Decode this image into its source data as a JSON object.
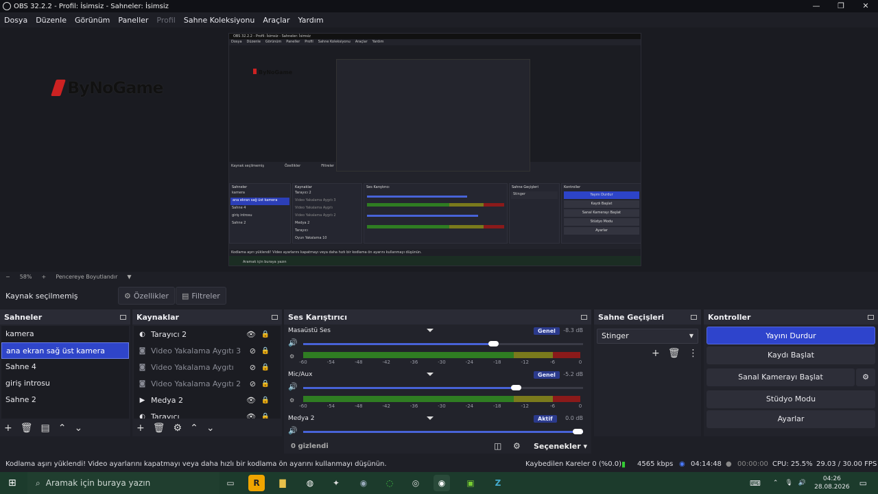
{
  "window": {
    "title": "OBS 32.2.2 - Profil: İsimsiz - Sahneler: İsimsiz",
    "controls": [
      "—",
      "❐",
      "✕"
    ]
  },
  "menu": [
    "Dosya",
    "Düzenle",
    "Görünüm",
    "Paneller",
    "Profil",
    "Sahne Koleksiyonu",
    "Araçlar",
    "Yardım"
  ],
  "preview": {
    "logo_text": "ByNoGame",
    "nested": {
      "title": "OBS 32.2.2 - Profil: İsimsiz - Sahneler: İsimsiz",
      "menu": [
        "Dosya",
        "Düzenle",
        "Görünüm",
        "Paneller",
        "Profil",
        "Sahne Koleksiyonu",
        "Araçlar",
        "Yardım"
      ],
      "logo_text": "ByNoGame",
      "no_source": "Kaynak seçilmemiş",
      "props": "Özellikler",
      "filters": "Filtreler",
      "scenes_title": "Sahneler",
      "scenes": [
        "kamera",
        "ana ekran sağ üst kamera",
        "Sahne 4",
        "giriş introsu",
        "Sahne 2"
      ],
      "sources_title": "Kaynaklar",
      "sources": [
        "Tarayıcı 2",
        "Video Yakalama Aygıtı 3",
        "Video Yakalama Aygıtı",
        "Video Yakalama Aygıtı 2",
        "Medya 2",
        "Tarayıcı",
        "Oyun Yakalama 10"
      ],
      "mixer_title": "Ses Karıştırıcı",
      "transitions_title": "Sahne Geçişleri",
      "transition": "Stinger",
      "controls_title": "Kontroller",
      "controls": [
        "Yayını Durdur",
        "Kaydı Başlat",
        "Sanal Kamerayı Başlat",
        "Stüdyo Modu",
        "Ayarlar"
      ],
      "status": "Kodlama aşırı yüklendi! Video ayarlarını kapatmayı veya daha hızlı bir kodlama ön ayarını kullanmayı düşünün.",
      "search": "Aramak için buraya yazın"
    }
  },
  "zoom": {
    "value": "58%",
    "fit": "Pencereye Boyutlandır"
  },
  "toolbar": {
    "no_source": "Kaynak seçilmemiş",
    "properties": "Özellikler",
    "filters": "Filtreler"
  },
  "scenes": {
    "title": "Sahneler",
    "items": [
      "kamera",
      "ana ekran sağ üst  kamera",
      "Sahne 4",
      "giriş introsu",
      "Sahne 2"
    ],
    "selected_index": 1
  },
  "sources": {
    "title": "Kaynaklar",
    "items": [
      {
        "label": "Tarayıcı 2",
        "icon": "browser-icon",
        "visible": true
      },
      {
        "label": "Video Yakalama Aygıtı 3",
        "icon": "camera-icon",
        "visible": false
      },
      {
        "label": "Video Yakalama Aygıtı",
        "icon": "camera-icon",
        "visible": false
      },
      {
        "label": "Video Yakalama Aygıtı 2",
        "icon": "camera-icon",
        "visible": false
      },
      {
        "label": "Medya 2",
        "icon": "play-icon",
        "visible": true
      },
      {
        "label": "Tarayıcı",
        "icon": "browser-icon",
        "visible": true
      },
      {
        "label": "Oyun Yakalama 10",
        "icon": "gamepad-icon",
        "visible": true
      }
    ]
  },
  "mixer": {
    "title": "Ses Karıştırıcı",
    "ticks": [
      "-60",
      "-54",
      "-48",
      "-42",
      "-36",
      "-30",
      "-24",
      "-18",
      "-12",
      "-6",
      "0"
    ],
    "channels": [
      {
        "name": "Masaüstü Ses",
        "badge": "Genel",
        "db": "-8.3 dB",
        "volume": 0.68
      },
      {
        "name": "Mic/Aux",
        "badge": "Genel",
        "db": "-5.2 dB",
        "volume": 0.76
      },
      {
        "name": "Medya 2",
        "badge": "Aktif",
        "db": "0.0 dB",
        "volume": 1.0
      }
    ],
    "hidden": "0 gizlendi",
    "options": "Seçenekler"
  },
  "transitions": {
    "title": "Sahne Geçişleri",
    "selected": "Stinger"
  },
  "controls": {
    "title": "Kontroller",
    "stream": "Yayını Durdur",
    "record": "Kaydı Başlat",
    "virtualcam": "Sanal Kamerayı Başlat",
    "studio": "Stüdyo Modu",
    "settings": "Ayarlar"
  },
  "status": {
    "message": "Kodlama aşırı yüklendi! Video ayarlarını kapatmayı veya daha hızlı bir kodlama ön ayarını kullanmayı düşünün.",
    "dropped": "Kaybedilen Kareler 0 (%0.0)",
    "bitrate": "4565 kbps",
    "stream_time": "04:14:48",
    "rec_time": "00:00:00",
    "cpu": "CPU: 25.5%",
    "fps": "29.03 / 30.00 FPS"
  },
  "taskbar": {
    "search_placeholder": "Aramak için buraya yazın",
    "time": "04:26",
    "date": "28.08.2026"
  },
  "colors": {
    "accent": "#2e44cc",
    "meter_green": "#2f7d22",
    "meter_yellow": "#7a7a1c",
    "meter_red": "#8b1a1a"
  }
}
